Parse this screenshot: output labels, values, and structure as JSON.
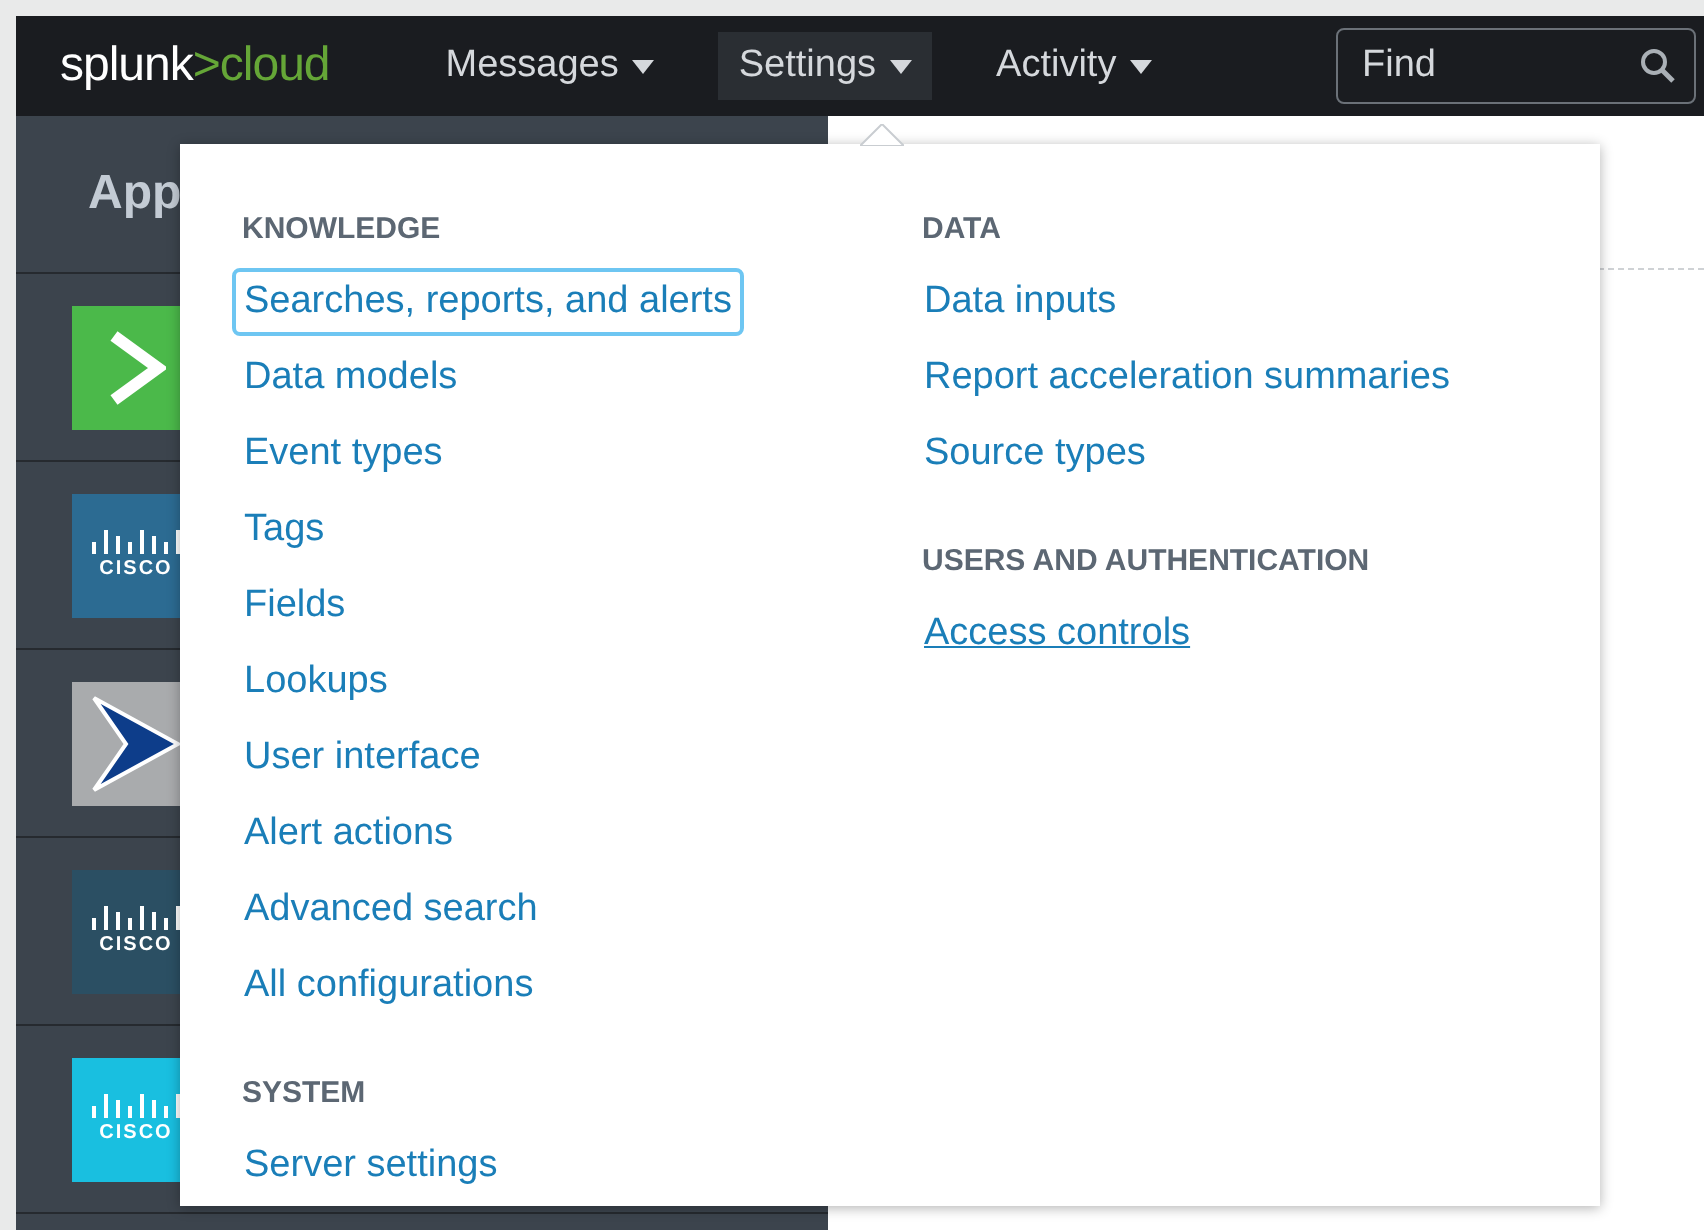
{
  "navbar": {
    "logo_main": "splunk",
    "logo_accent": ">cloud",
    "menus": [
      {
        "label": "Messages",
        "selected": false
      },
      {
        "label": "Settings",
        "selected": true
      },
      {
        "label": "Activity",
        "selected": false
      }
    ],
    "search": {
      "placeholder": "Find"
    }
  },
  "sidebar": {
    "heading": "App",
    "apps": [
      {
        "kind": "arrow",
        "color": "#4bb94a"
      },
      {
        "kind": "cisco",
        "color": "#2c6b92",
        "text": "CISCO"
      },
      {
        "kind": "chevron",
        "color": "#a9abad"
      },
      {
        "kind": "cisco",
        "color": "#2b4f63",
        "text": "CISCO"
      },
      {
        "kind": "cisco",
        "color": "#19bfe0",
        "text": "CISCO"
      }
    ]
  },
  "dropdown": {
    "columns": [
      {
        "sections": [
          {
            "heading": "KNOWLEDGE",
            "items": [
              {
                "label": "Searches, reports, and alerts",
                "focused": true,
                "hovered": false
              },
              {
                "label": "Data models",
                "focused": false,
                "hovered": false
              },
              {
                "label": "Event types",
                "focused": false,
                "hovered": false
              },
              {
                "label": "Tags",
                "focused": false,
                "hovered": false
              },
              {
                "label": "Fields",
                "focused": false,
                "hovered": false
              },
              {
                "label": "Lookups",
                "focused": false,
                "hovered": false
              },
              {
                "label": "User interface",
                "focused": false,
                "hovered": false
              },
              {
                "label": "Alert actions",
                "focused": false,
                "hovered": false
              },
              {
                "label": "Advanced search",
                "focused": false,
                "hovered": false
              },
              {
                "label": "All configurations",
                "focused": false,
                "hovered": false
              }
            ]
          },
          {
            "heading": "SYSTEM",
            "items": [
              {
                "label": "Server settings",
                "focused": false,
                "hovered": false
              }
            ]
          }
        ]
      },
      {
        "sections": [
          {
            "heading": "DATA",
            "items": [
              {
                "label": "Data inputs",
                "focused": false,
                "hovered": false
              },
              {
                "label": "Report acceleration summaries",
                "focused": false,
                "hovered": false
              },
              {
                "label": "Source types",
                "focused": false,
                "hovered": false
              }
            ]
          },
          {
            "heading": "USERS AND AUTHENTICATION",
            "items": [
              {
                "label": "Access controls",
                "focused": false,
                "hovered": true
              }
            ]
          }
        ]
      }
    ]
  }
}
